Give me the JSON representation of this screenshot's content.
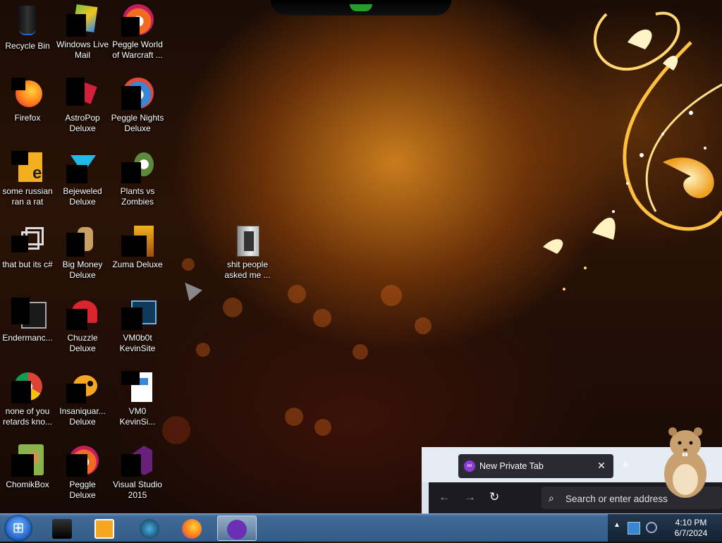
{
  "desktop_icons": [
    {
      "id": "recycle-bin",
      "label": "Recycle Bin"
    },
    {
      "id": "windows-live-mail",
      "label": "Windows Live Mail"
    },
    {
      "id": "peggle-world-of-warcraft",
      "label": "Peggle World of Warcraft ..."
    },
    {
      "id": "firefox",
      "label": "Firefox"
    },
    {
      "id": "astropop-deluxe",
      "label": "AstroPop Deluxe"
    },
    {
      "id": "peggle-nights-deluxe",
      "label": "Peggle Nights Deluxe"
    },
    {
      "id": "some-russian-ran-a-rat",
      "label": "some russian ran a rat"
    },
    {
      "id": "bejeweled-deluxe",
      "label": "Bejeweled Deluxe"
    },
    {
      "id": "plants-vs-zombies",
      "label": "Plants vs Zombies"
    },
    {
      "id": "that-but-its-c",
      "label": "that but its c#"
    },
    {
      "id": "big-money-deluxe",
      "label": "Big Money Deluxe"
    },
    {
      "id": "zuma-deluxe",
      "label": "Zuma Deluxe"
    },
    {
      "id": "endermanc",
      "label": "Endermanc..."
    },
    {
      "id": "chuzzle-deluxe",
      "label": "Chuzzle Deluxe"
    },
    {
      "id": "vm0b0t-kevinsite",
      "label": "VM0b0t KevinSite"
    },
    {
      "id": "none-of-you",
      "label": "none of you retards kno..."
    },
    {
      "id": "insaniquarium-deluxe",
      "label": "Insaniquar... Deluxe"
    },
    {
      "id": "vm0-kevinsi",
      "label": "VM0 KevinSi..."
    },
    {
      "id": "chomikbox",
      "label": "ChomikBox"
    },
    {
      "id": "peggle-deluxe",
      "label": "Peggle Deluxe"
    },
    {
      "id": "visual-studio-2015",
      "label": "Visual Studio 2015"
    },
    {
      "id": "shit-people-asked-me",
      "label": "shit people asked me ..."
    }
  ],
  "browser": {
    "tab_title": "New Private Tab",
    "close_glyph": "✕",
    "new_tab_glyph": "+",
    "back_glyph": "←",
    "forward_glyph": "→",
    "reload_glyph": "↻",
    "search_placeholder": "Search or enter address"
  },
  "taskbar": {
    "start_glyph": "⊞",
    "tray_chevron": "▲",
    "clock_time": "4:10 PM",
    "clock_date": "6/7/2024"
  },
  "icons": {
    "start": "windows-orb-icon",
    "search": "magnifier-icon",
    "private": "private-mask-icon"
  }
}
